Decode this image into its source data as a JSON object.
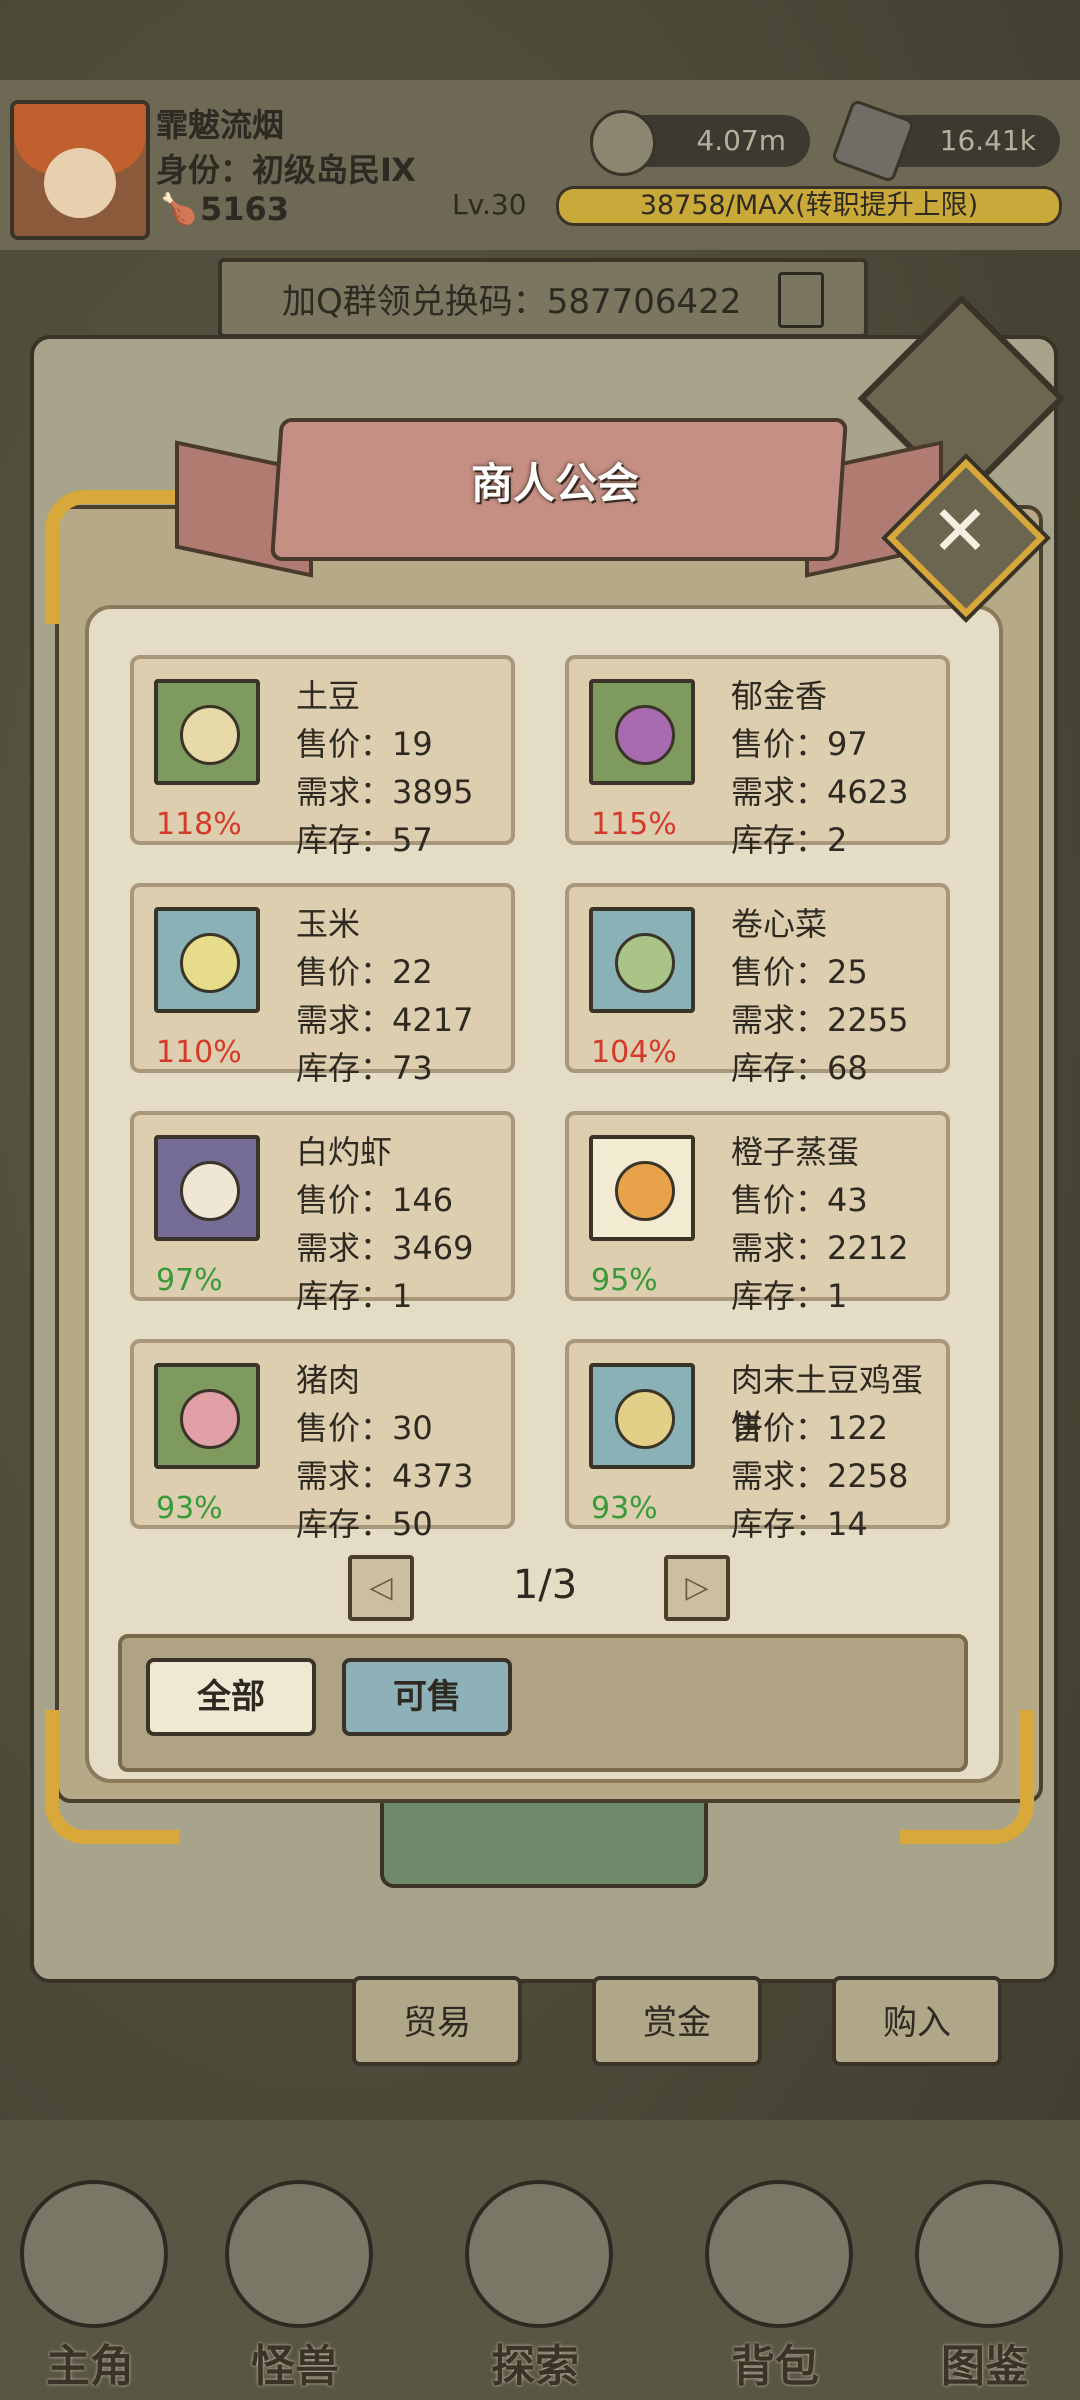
{
  "player": {
    "name": "霏魃流烟",
    "role": "身份：初级岛民Ⅸ",
    "food": "5163",
    "level": "Lv.30",
    "exp": "38758/MAX(转职提升上限)",
    "coins": "4.07m",
    "stones": "16.41k"
  },
  "invite": {
    "text": "加Q群领兑换码：587706422"
  },
  "dialog": {
    "title": "商人公会",
    "close": "✕"
  },
  "labels": {
    "price": "售价：",
    "demand": "需求：",
    "stock": "库存："
  },
  "items": [
    {
      "name": "土豆",
      "price": "19",
      "demand": "3895",
      "stock": "57",
      "pct": "118%",
      "pct_color": "#d43a2a",
      "bg": "#7f9a5e",
      "food": "#e8d9a8"
    },
    {
      "name": "郁金香",
      "price": "97",
      "demand": "4623",
      "stock": "2",
      "pct": "115%",
      "pct_color": "#d43a2a",
      "bg": "#7f9a5e",
      "food": "#a86bb0"
    },
    {
      "name": "玉米",
      "price": "22",
      "demand": "4217",
      "stock": "73",
      "pct": "110%",
      "pct_color": "#d43a2a",
      "bg": "#8ab1b6",
      "food": "#e6dc8a"
    },
    {
      "name": "卷心菜",
      "price": "25",
      "demand": "2255",
      "stock": "68",
      "pct": "104%",
      "pct_color": "#d43a2a",
      "bg": "#8ab1b6",
      "food": "#a9c486"
    },
    {
      "name": "白灼虾",
      "price": "146",
      "demand": "3469",
      "stock": "1",
      "pct": "97%",
      "pct_color": "#3a9a3a",
      "bg": "#746c94",
      "food": "#efe6d6"
    },
    {
      "name": "橙子蒸蛋",
      "price": "43",
      "demand": "2212",
      "stock": "1",
      "pct": "95%",
      "pct_color": "#3a9a3a",
      "bg": "#f3ead2",
      "food": "#e8a24a"
    },
    {
      "name": "猪肉",
      "price": "30",
      "demand": "4373",
      "stock": "50",
      "pct": "93%",
      "pct_color": "#3a9a3a",
      "bg": "#7f9a5e",
      "food": "#e0a0a6"
    },
    {
      "name": "肉末土豆鸡蛋饼",
      "price": "122",
      "demand": "2258",
      "stock": "14",
      "pct": "93%",
      "pct_color": "#3a9a3a",
      "bg": "#8ab1b6",
      "food": "#e2d088"
    }
  ],
  "pager": {
    "page": "1/3",
    "prev": "◁",
    "next": "▷"
  },
  "filters": {
    "all": "全部",
    "sellable": "可售"
  },
  "tabs": {
    "trade": "贸易",
    "bounty": "赏金",
    "buy": "购入"
  },
  "nav": {
    "hero": "主角",
    "monster": "怪兽",
    "explore": "探索",
    "bag": "背包",
    "guide": "图鉴"
  }
}
